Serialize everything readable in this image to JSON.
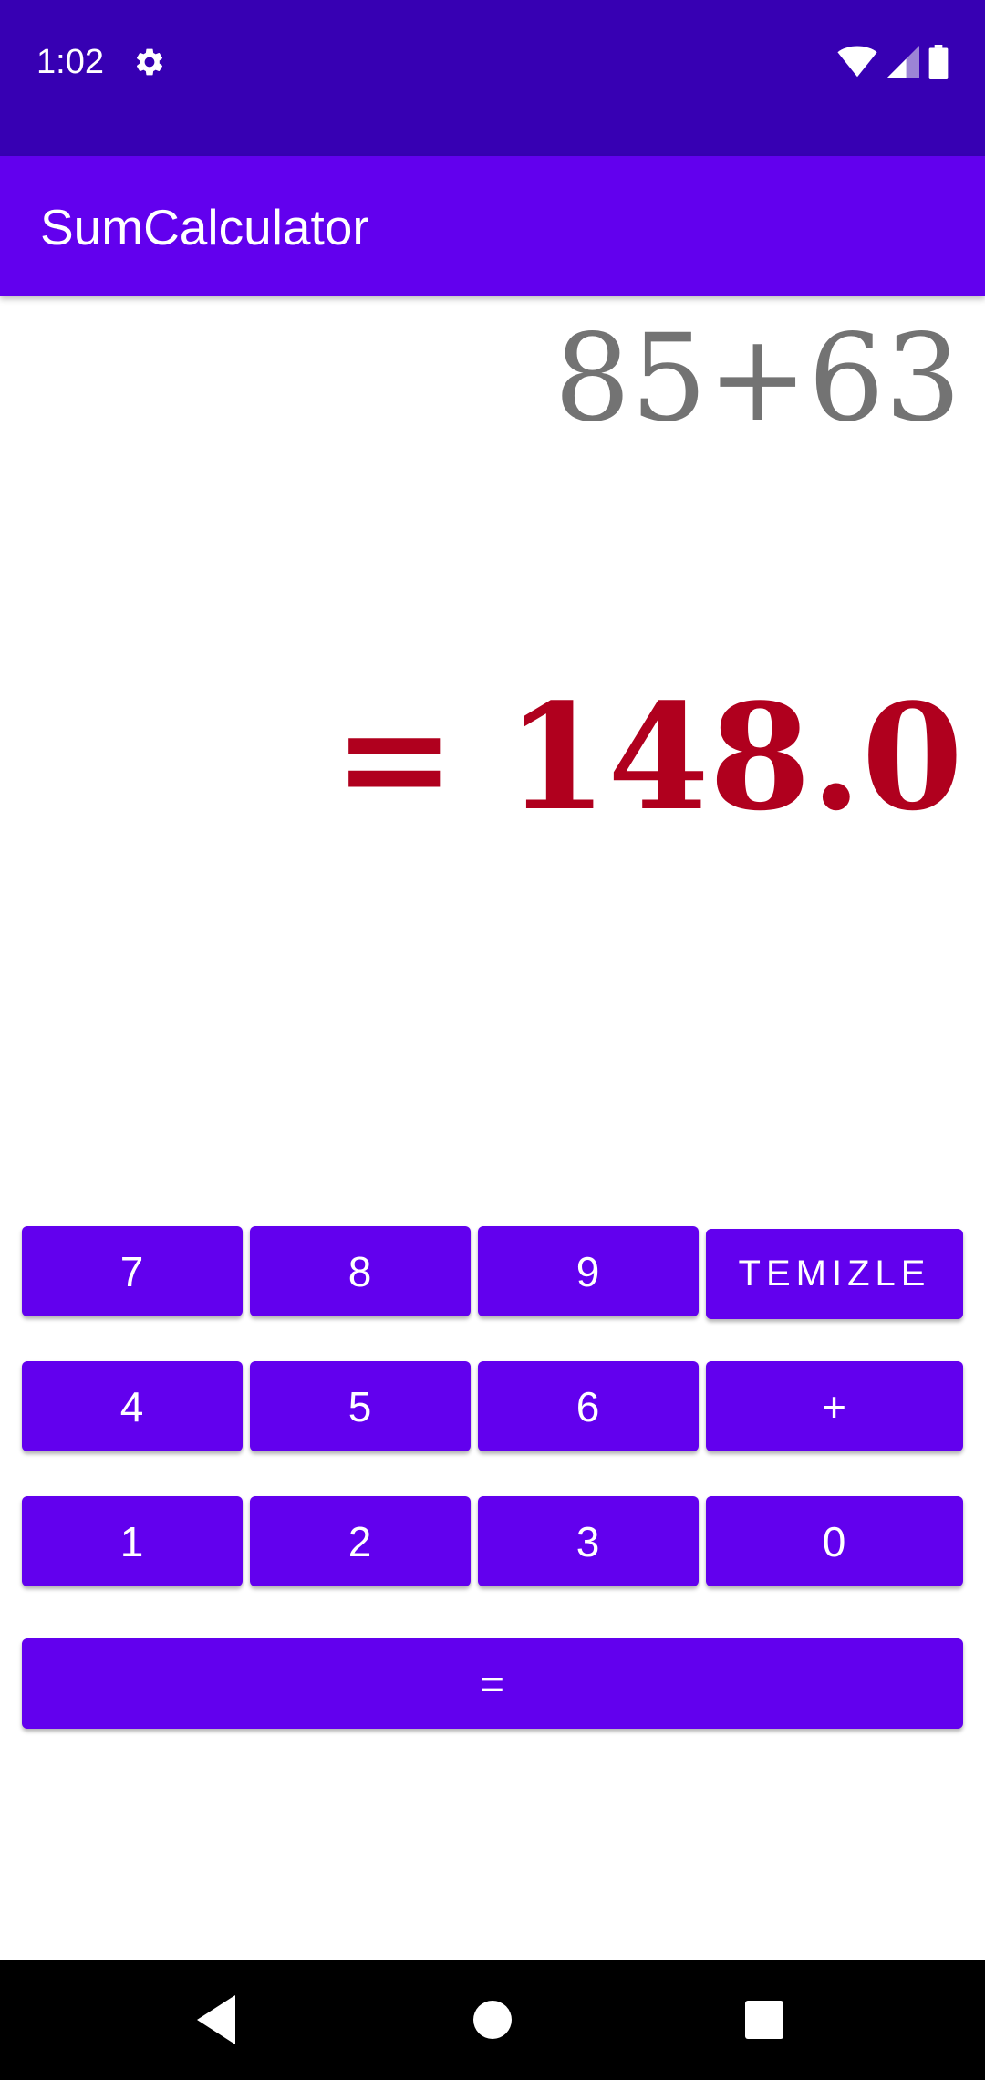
{
  "status_bar": {
    "time": "1:02",
    "icons": [
      "settings-gear-icon",
      "wifi-icon",
      "cell-signal-icon",
      "battery-icon"
    ],
    "background": "#3700b3"
  },
  "app_bar": {
    "title": "SumCalculator",
    "background": "#6200ee"
  },
  "display": {
    "expression": "85+63",
    "result": "= 148.0",
    "expression_color": "#737373",
    "result_color": "#b0001e"
  },
  "keypad": {
    "button_color": "#6200ee",
    "rows": [
      [
        "7",
        "8",
        "9",
        "TEMIZLE"
      ],
      [
        "4",
        "5",
        "6",
        "+"
      ],
      [
        "1",
        "2",
        "3",
        "0"
      ],
      [
        "="
      ]
    ]
  },
  "nav_bar": {
    "icons": [
      "back-icon",
      "home-icon",
      "recents-icon"
    ]
  }
}
